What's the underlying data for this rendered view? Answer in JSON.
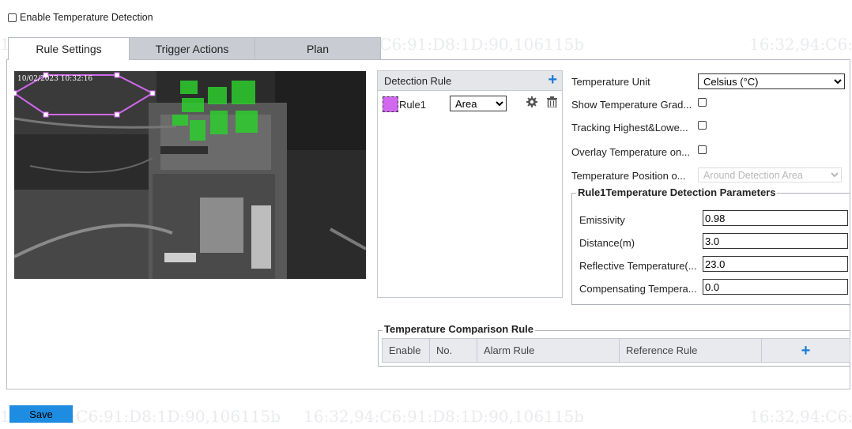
{
  "watermark": "16:32,94:C6:91:D8:1D:90,106115b",
  "enable": {
    "label": "Enable Temperature Detection",
    "checked": false
  },
  "tabs": [
    {
      "label": "Rule Settings",
      "active": true
    },
    {
      "label": "Trigger Actions",
      "active": false
    },
    {
      "label": "Plan",
      "active": false
    }
  ],
  "video": {
    "osd_time": "10/02/2023 10:32:16"
  },
  "rules": {
    "header": "Detection Rule",
    "items": [
      {
        "name": "Rule1",
        "type": "Area",
        "color": "#d169ee"
      }
    ],
    "type_options": [
      "Area"
    ]
  },
  "settings": {
    "temperature_unit": {
      "label": "Temperature Unit",
      "value": "Celsius (°C)"
    },
    "show_gradient": {
      "label": "Show Temperature Grad...",
      "checked": false
    },
    "tracking": {
      "label": "Tracking Highest&Lowe...",
      "checked": false
    },
    "overlay": {
      "label": "Overlay Temperature on...",
      "checked": false
    },
    "position": {
      "label": "Temperature Position o...",
      "value": "Around Detection Area",
      "disabled": true
    }
  },
  "params": {
    "title": "Rule1Temperature Detection Parameters",
    "fields": [
      {
        "label": "Emissivity",
        "value": "0.98"
      },
      {
        "label": "Distance(m)",
        "value": "3.0"
      },
      {
        "label": "Reflective Temperature(...",
        "value": "23.0"
      },
      {
        "label": "Compensating Tempera...",
        "value": "0.0"
      }
    ]
  },
  "comparison": {
    "title": "Temperature Comparison Rule",
    "columns": [
      "Enable",
      "No.",
      "Alarm Rule",
      "Reference Rule"
    ]
  },
  "save_label": "Save",
  "colors": {
    "accent": "#1a7ad3",
    "save_button": "#1e8ce0",
    "rule_area": "#d169ee",
    "heat_cell": "#2ecc2e"
  }
}
